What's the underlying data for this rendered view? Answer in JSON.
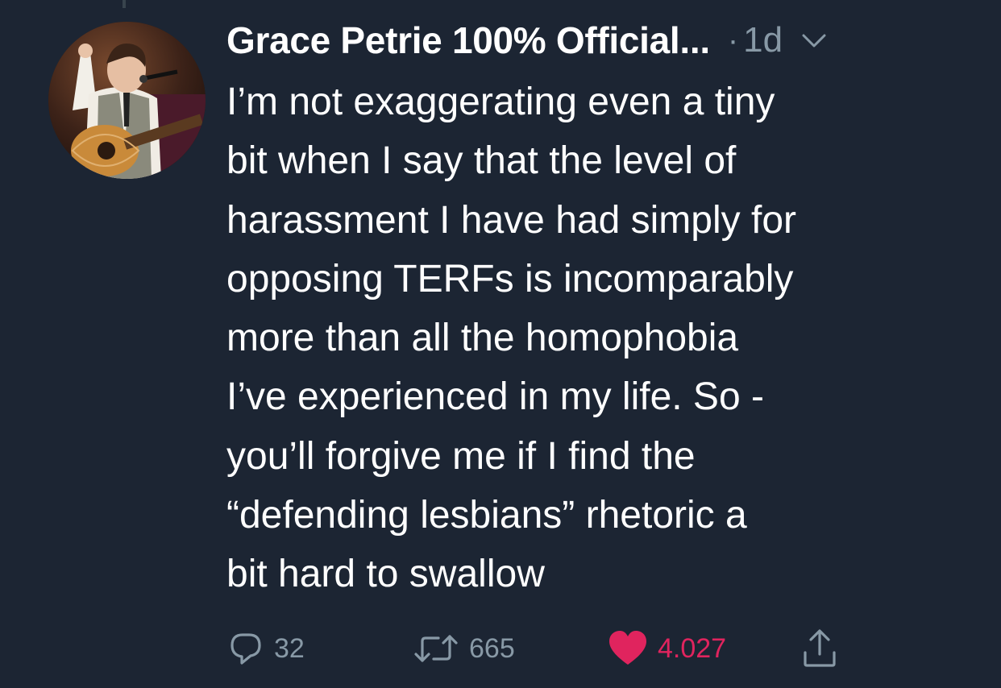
{
  "tweet": {
    "author_name": "Grace Petrie 100% Official...",
    "separator": "·",
    "timestamp": "1d",
    "text_lines": [
      "I’m not exaggerating even a tiny",
      "bit when I say that the level of",
      "harassment I have had simply for",
      "opposing TERFs is incomparably",
      "more than all the homophobia",
      "I’ve experienced in my life. So -",
      "you’ll forgive me if I find the",
      "“defending lesbians” rhetoric a",
      "bit hard to swallow"
    ],
    "actions": {
      "reply_count": "32",
      "retweet_count": "665",
      "like_count": "4.027"
    }
  },
  "colors": {
    "background": "#1c2533",
    "text": "#ffffff",
    "muted": "#8899a6",
    "like": "#e0245e"
  },
  "icons": {
    "reply": "reply-icon",
    "retweet": "retweet-icon",
    "like": "heart-icon",
    "share": "share-icon",
    "menu": "chevron-down-icon"
  }
}
